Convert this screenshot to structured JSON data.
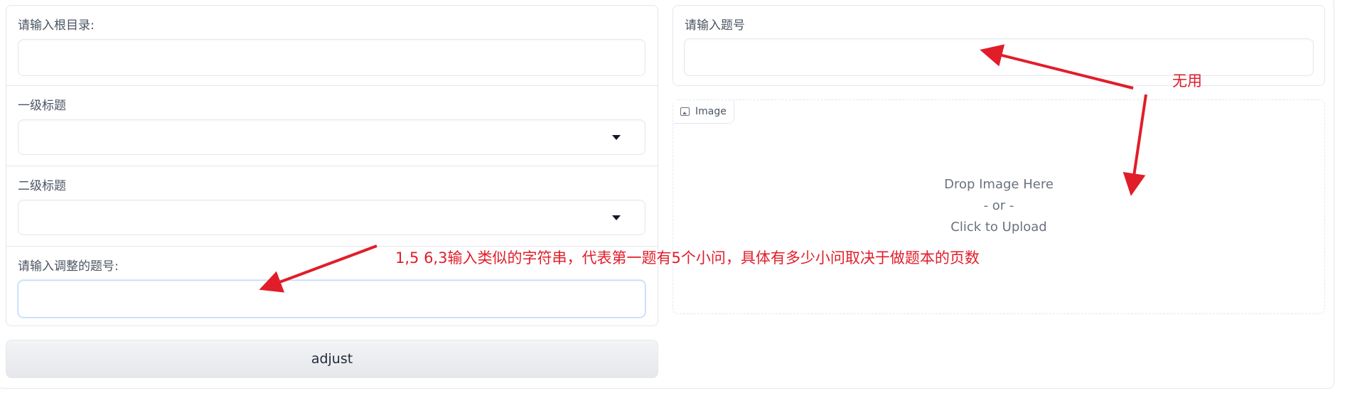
{
  "left_panel": {
    "root_dir": {
      "label": "请输入根目录:",
      "value": ""
    },
    "level1": {
      "label": "一级标题",
      "value": ""
    },
    "level2": {
      "label": "二级标题",
      "value": ""
    },
    "adjust_numbers": {
      "label": "请输入调整的题号:",
      "value": ""
    }
  },
  "adjust_button": {
    "label": "adjust"
  },
  "right_panel": {
    "question_number": {
      "label": "请输入题号",
      "value": ""
    },
    "image_upload": {
      "tag_label": "Image",
      "drop_text": "Drop Image Here",
      "or_text": "- or -",
      "click_text": "Click to Upload"
    }
  },
  "annotations": {
    "useless_note": "无用",
    "format_note": "1,5 6,3输入类似的字符串，代表第一题有5个小问，具体有多少小问取决于做题本的页数",
    "color": "#e11d2a"
  },
  "icons": {
    "dropdown": "chevron-down-icon",
    "image": "image-icon"
  }
}
